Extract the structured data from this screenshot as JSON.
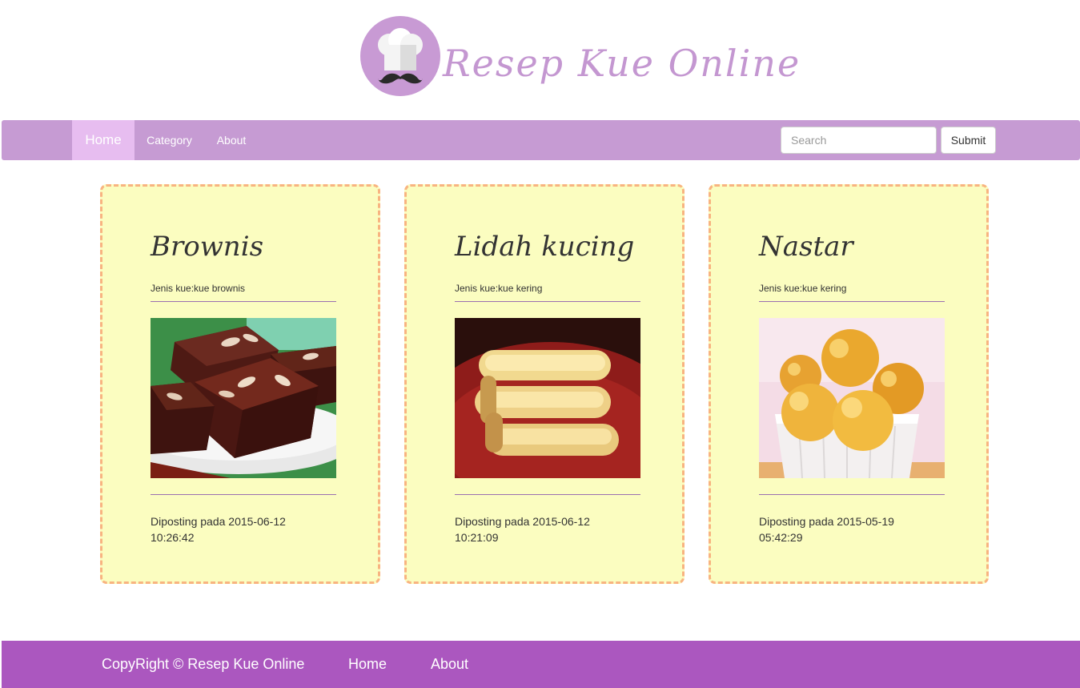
{
  "brand": {
    "title": "Resep Kue Online",
    "logo_icon": "chef-hat-mustache-icon",
    "logo_bg": "#c89ad4"
  },
  "nav": {
    "items": [
      {
        "label": "Home",
        "active": true
      },
      {
        "label": "Category",
        "active": false
      },
      {
        "label": "About",
        "active": false
      }
    ],
    "search_placeholder": "Search",
    "search_value": "",
    "submit_label": "Submit",
    "bg_color": "#c69bd3",
    "active_color": "#e7bdf0"
  },
  "cards": [
    {
      "title": "Brownis",
      "type": "Jenis kue:kue brownis",
      "image": "brownies-photo",
      "posted_line1": "Diposting pada 2015-06-12",
      "posted_line2": "10:26:42"
    },
    {
      "title": "Lidah kucing",
      "type": "Jenis kue:kue kering",
      "image": "lidah-kucing-cookies-photo",
      "posted_line1": "Diposting pada 2015-06-12",
      "posted_line2": "10:21:09"
    },
    {
      "title": "Nastar",
      "type": "Jenis kue:kue kering",
      "image": "nastar-pineapple-tarts-photo",
      "posted_line1": "Diposting pada 2015-05-19",
      "posted_line2": "05:42:29"
    }
  ],
  "card_style": {
    "bg_color": "#fbfdc0",
    "border_color": "#f8b480"
  },
  "footer": {
    "copyright": "CopyRight © Resep Kue Online",
    "links": [
      "Home",
      "About"
    ],
    "bg_color": "#ab57bf"
  }
}
